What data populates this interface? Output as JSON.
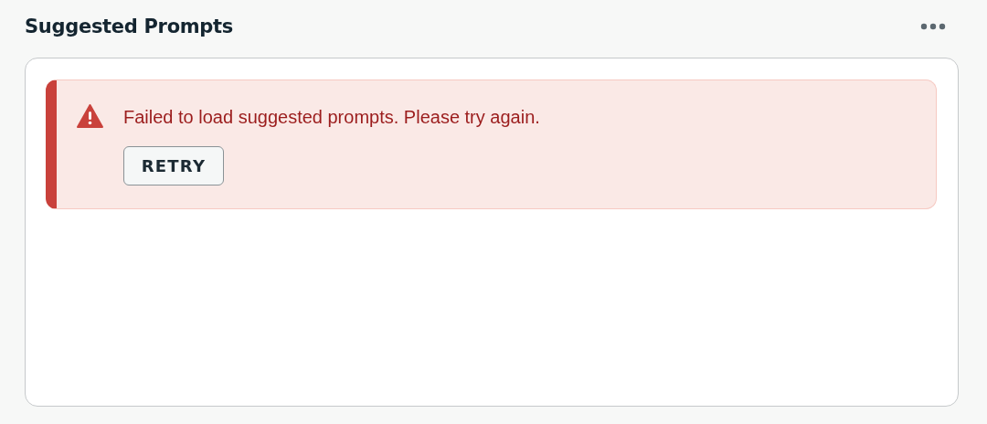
{
  "panel": {
    "title": "Suggested Prompts"
  },
  "alert": {
    "kind": "error",
    "message": "Failed to load suggested prompts. Please try again.",
    "action": "RETRY"
  }
}
